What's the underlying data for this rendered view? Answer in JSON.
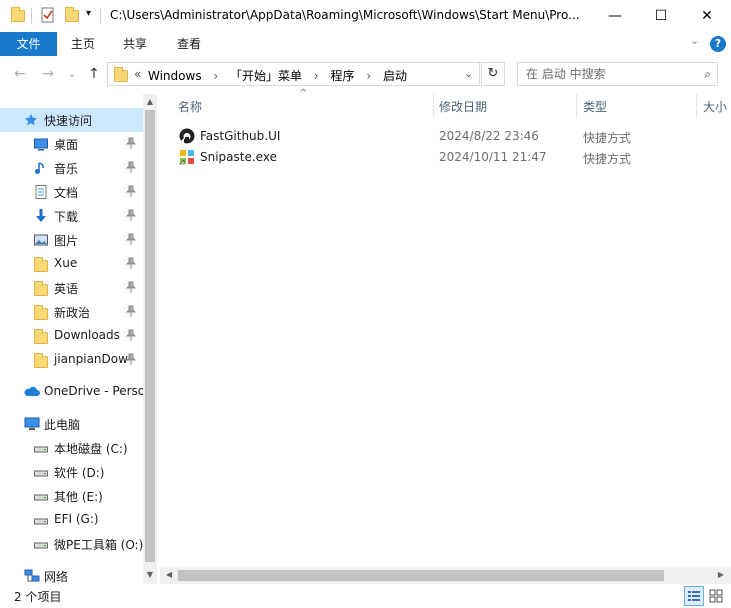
{
  "titlebar": {
    "path": "C:\\Users\\Administrator\\AppData\\Roaming\\Microsoft\\Windows\\Start Menu\\Pro...",
    "quick_access_dropdown": "▾",
    "minimize": "—",
    "maximize": "☐",
    "close": "✕"
  },
  "ribbon": {
    "tabs": [
      {
        "label": "文件",
        "active": true
      },
      {
        "label": "主页"
      },
      {
        "label": "共享"
      },
      {
        "label": "查看"
      }
    ],
    "collapse_icon": "⌄",
    "help": "?"
  },
  "address": {
    "back": "←",
    "forward": "→",
    "recent": "⌄",
    "up": "↑",
    "overflow": "«",
    "crumbs": [
      "Windows",
      "「开始」菜单",
      "程序",
      "启动"
    ],
    "crumb_sep": "›",
    "dropdown": "⌄",
    "refresh": "↻",
    "search_placeholder": "在 启动 中搜索",
    "search_icon": "⌕"
  },
  "nav": {
    "items": [
      {
        "label": "快速访问",
        "icon": "star-icon",
        "pinned": false,
        "selected": true
      },
      {
        "label": "桌面",
        "icon": "desktop-icon",
        "pinned": true
      },
      {
        "label": "音乐",
        "icon": "music-icon",
        "pinned": true
      },
      {
        "label": "文档",
        "icon": "document-icon",
        "pinned": true
      },
      {
        "label": "下载",
        "icon": "download-icon",
        "pinned": true
      },
      {
        "label": "图片",
        "icon": "picture-icon",
        "pinned": true
      },
      {
        "label": "Xue",
        "icon": "folder-icon",
        "pinned": true
      },
      {
        "label": "英语",
        "icon": "folder-icon",
        "pinned": true
      },
      {
        "label": "新政治",
        "icon": "folder-icon",
        "pinned": true
      },
      {
        "label": "Downloads",
        "icon": "folder-icon",
        "pinned": true
      },
      {
        "label": "jianpianDow",
        "icon": "folder-icon",
        "pinned": true
      },
      {
        "label": "OneDrive - Perso",
        "icon": "cloud-icon",
        "pinned": false
      },
      {
        "label": "此电脑",
        "icon": "computer-icon",
        "pinned": false
      },
      {
        "label": "本地磁盘 (C:)",
        "icon": "drive-icon",
        "pinned": false
      },
      {
        "label": "软件 (D:)",
        "icon": "drive-icon",
        "pinned": false
      },
      {
        "label": "其他 (E:)",
        "icon": "drive-icon",
        "pinned": false
      },
      {
        "label": "EFI (G:)",
        "icon": "drive-icon",
        "pinned": false
      },
      {
        "label": "微PE工具箱 (O:)",
        "icon": "drive-icon",
        "pinned": false
      },
      {
        "label": "网络",
        "icon": "network-icon",
        "pinned": false
      }
    ],
    "pin_glyph": "📌"
  },
  "content": {
    "columns": [
      "名称",
      "修改日期",
      "类型",
      "大小"
    ],
    "sort_indicator": "^",
    "files": [
      {
        "name": "FastGithub.UI",
        "date": "2024/8/22 23:46",
        "type": "快捷方式"
      },
      {
        "name": "Snipaste.exe",
        "date": "2024/10/11 21:47",
        "type": "快捷方式"
      }
    ]
  },
  "status": {
    "count": "2 个项目"
  },
  "colors": {
    "accent": "#1979ca",
    "selected_bg": "#cce8ff",
    "folder": "#f8d775"
  }
}
